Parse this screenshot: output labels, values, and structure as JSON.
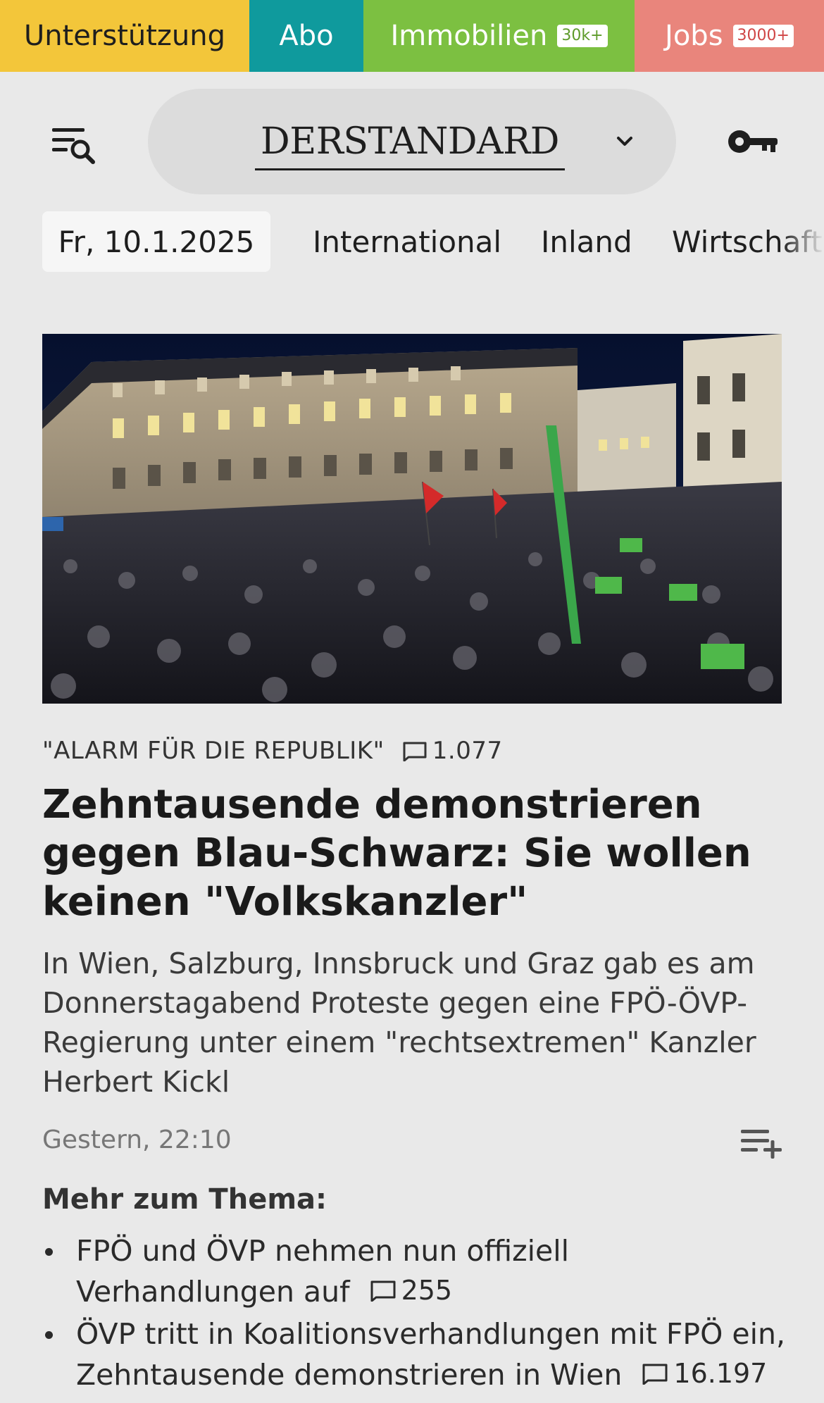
{
  "topbar": {
    "support_label": "Unterstützung",
    "abo_label": "Abo",
    "immobilien_label": "Immobilien",
    "immobilien_badge": "30k+",
    "jobs_label": "Jobs",
    "jobs_badge": "3000+"
  },
  "header": {
    "logo_text": "DERSTANDARD",
    "menu_icon": "menu-search-icon",
    "dropdown_icon": "chevron-down-icon",
    "login_icon": "key-icon"
  },
  "nav": {
    "date": "Fr, 10.1.2025",
    "items": [
      "International",
      "Inland",
      "Wirtschaft"
    ]
  },
  "article": {
    "kicker": "\"ALARM FÜR DIE REPUBLIK\"",
    "postings": "1.077",
    "headline": "Zehntausende demonstrieren gegen Blau-Schwarz: Sie wollen keinen \"Volkskanzler\"",
    "lead": "In Wien, Salzburg, Innsbruck und Graz gab es am Donnerstagabend Proteste gegen eine FPÖ-ÖVP-Regierung unter einem \"rechtsextremen\" Kanzler Herbert Kickl",
    "timestamp": "Gestern, 22:10",
    "more_title": "Mehr zum Thema:",
    "more_items": [
      {
        "text": "FPÖ und ÖVP nehmen nun offiziell Verhandlungen auf",
        "postings": "255"
      },
      {
        "text": "ÖVP tritt in Koalitionsverhandlungen mit FPÖ ein, Zehntausende demonstrieren in Wien",
        "postings": "16.197"
      }
    ]
  },
  "colors": {
    "support": "#f3c63a",
    "abo": "#0f9a9d",
    "immobilien": "#7cc041",
    "jobs": "#e9857c",
    "background": "#e9e9e9"
  }
}
